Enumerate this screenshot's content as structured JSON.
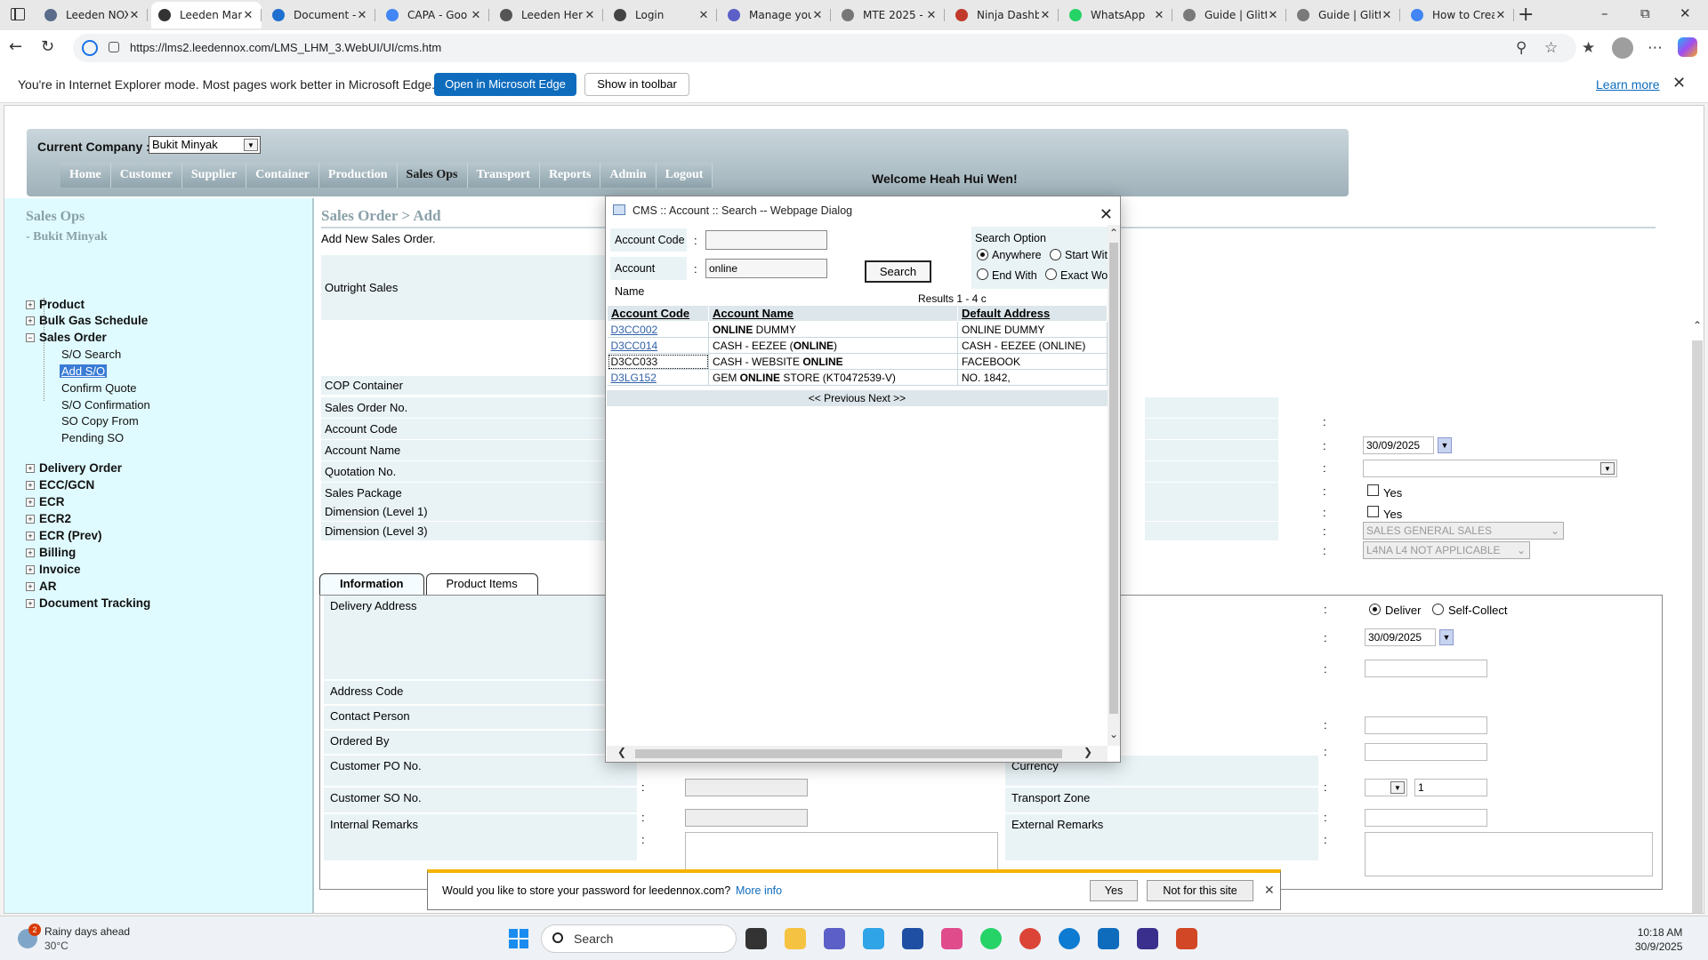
{
  "browser": {
    "tabs": [
      {
        "label": "Leeden NOX",
        "active": false,
        "icon": "globe-icon",
        "color": "#5a6b8c"
      },
      {
        "label": "Leeden Man",
        "active": true,
        "icon": "ie-icon",
        "color": "#333333"
      },
      {
        "label": "Document -",
        "active": false,
        "icon": "cloud-doc-icon",
        "color": "#1f6fd0"
      },
      {
        "label": "CAPA - Goo",
        "active": false,
        "icon": "google-icon",
        "color": "#4285f4"
      },
      {
        "label": "Leeden Her",
        "active": false,
        "icon": "map-pin-icon",
        "color": "#555555"
      },
      {
        "label": "Login",
        "active": false,
        "icon": "gmail-icon",
        "color": "#444444"
      },
      {
        "label": "Manage you",
        "active": false,
        "icon": "arrow-icon",
        "color": "#5b5fc7"
      },
      {
        "label": "MTE 2025 -",
        "active": false,
        "icon": "globe-icon",
        "color": "#777777"
      },
      {
        "label": "Ninja Dashb",
        "active": false,
        "icon": "ninja-icon",
        "color": "#c0392b"
      },
      {
        "label": "WhatsApp",
        "active": false,
        "icon": "whatsapp-icon",
        "color": "#25d366"
      },
      {
        "label": "Guide | Glitt",
        "active": false,
        "icon": "google-icon",
        "color": "#7a7a7a"
      },
      {
        "label": "Guide | Glitt",
        "active": false,
        "icon": "google-icon",
        "color": "#7a7a7a"
      },
      {
        "label": "How to Crea",
        "active": false,
        "icon": "google-icon",
        "color": "#4285f4"
      }
    ],
    "url": "https://lms2.leedennox.com/LMS_LHM_3.WebUI/UI/cms.htm"
  },
  "iebar": {
    "message": "You're in Internet Explorer mode. Most pages work better in Microsoft Edge.",
    "open_button": "Open in Microsoft Edge",
    "toolbar_button": "Show in toolbar",
    "learn_more": "Learn more"
  },
  "header": {
    "company_label": "Current Company :",
    "company_value": "Bukit Minyak",
    "menu": [
      "Home",
      "Customer",
      "Supplier",
      "Container",
      "Production",
      "Sales Ops",
      "Transport",
      "Reports",
      "Admin",
      "Logout"
    ],
    "active_menu": "Sales Ops",
    "welcome": "Welcome Heah Hui Wen!"
  },
  "sidebar": {
    "title": "Sales Ops",
    "subtitle": "- Bukit Minyak",
    "items": [
      {
        "label": "Product",
        "expanded": false
      },
      {
        "label": "Bulk Gas Schedule",
        "expanded": false
      },
      {
        "label": "Sales Order",
        "expanded": true
      },
      {
        "label": "Delivery Order",
        "expanded": false
      },
      {
        "label": "ECC/GCN",
        "expanded": false
      },
      {
        "label": "ECR",
        "expanded": false
      },
      {
        "label": "ECR2",
        "expanded": false
      },
      {
        "label": "ECR (Prev)",
        "expanded": false
      },
      {
        "label": "Billing",
        "expanded": false
      },
      {
        "label": "Invoice",
        "expanded": false
      },
      {
        "label": "AR",
        "expanded": false
      },
      {
        "label": "Document Tracking",
        "expanded": false
      }
    ],
    "sales_order_children": [
      "S/O Search",
      "Add S/O",
      "Confirm Quote",
      "S/O Confirmation",
      "SO Copy From",
      "Pending SO"
    ],
    "selected_child": "Add S/O"
  },
  "form": {
    "title": "Sales Order > Add",
    "description": "Add New Sales Order.",
    "rows": [
      "Outright Sales",
      "COP Container",
      "Sales Order No.",
      "Account Code",
      "Account Name",
      "Quotation No.",
      "Sales Package",
      "Dimension (Level 1)",
      "Dimension (Level 3)"
    ],
    "order_date": "30/09/2025",
    "yes_label": "Yes",
    "dimension1": "SALES GENERAL SALES",
    "dimension3": "L4NA L4 NOT APPLICABLE",
    "tabs": [
      "Information",
      "Product Items"
    ],
    "active_tab": "Information",
    "info_rows": [
      "Delivery Address",
      "Address Code",
      "Contact Person",
      "Ordered By",
      "Customer PO No.",
      "Customer SO No.",
      "Internal Remarks"
    ],
    "right_rows": [
      "Currency",
      "Transport Zone",
      "External Remarks"
    ],
    "deliver_label": "Deliver",
    "selfcollect_label": "Self-Collect",
    "delivery_date": "30/09/2025",
    "currency_rate": "1"
  },
  "dialog": {
    "title": "CMS :: Account :: Search -- Webpage Dialog",
    "account_code_label": "Account Code",
    "account_name_label": "Account Name",
    "account_code_value": "",
    "account_name_value": "online",
    "search_button": "Search",
    "search_option_label": "Search Option",
    "options": [
      "Anywhere",
      "Start Wit",
      "End With",
      "Exact Wo"
    ],
    "selected_option": "Anywhere",
    "results_text": "Results 1 - 4 c",
    "columns": [
      "Account Code",
      "Account Name",
      "Default Address"
    ],
    "rows": [
      {
        "code": "D3CC002",
        "name_pre": "",
        "name_bold": "ONLINE",
        "name_post": " DUMMY",
        "address": "ONLINE DUMMY"
      },
      {
        "code": "D3CC014",
        "name_pre": "CASH - EEZEE (",
        "name_bold": "ONLINE",
        "name_post": ")",
        "address": "CASH - EEZEE (ONLINE)"
      },
      {
        "code": "D3CC033",
        "name_pre": "CASH - WEBSITE ",
        "name_bold": "ONLINE",
        "name_post": "",
        "address": "FACEBOOK"
      },
      {
        "code": "D3LG152",
        "name_pre": "GEM ",
        "name_bold": "ONLINE",
        "name_post": " STORE (KT0472539-V)",
        "address": "NO. 1842,"
      }
    ],
    "pager": "<< Previous Next >>"
  },
  "password_bar": {
    "message": "Would you like to store your password for leedennox.com?",
    "more_info": "More info",
    "yes": "Yes",
    "no": "Not for this site"
  },
  "taskbar": {
    "weather_badge": "2",
    "weather_line1": "Rainy days ahead",
    "weather_line2": "30°C",
    "search_placeholder": "Search",
    "time": "10:18 AM",
    "date": "30/9/2025",
    "apps": [
      {
        "icon": "task-view-icon",
        "color": "#333333"
      },
      {
        "icon": "file-explorer-icon",
        "color": "#f5c242"
      },
      {
        "icon": "teams-icon",
        "color": "#5b5fc7"
      },
      {
        "icon": "copilot-icon",
        "color": "#2fa4e7"
      },
      {
        "icon": "outlook-calendar-icon",
        "color": "#1e4fa3"
      },
      {
        "icon": "snipping-tool-icon",
        "color": "#e04b8c"
      },
      {
        "icon": "whatsapp-icon",
        "color": "#25d366"
      },
      {
        "icon": "chrome-icon",
        "color": "#db4437"
      },
      {
        "icon": "edge-icon",
        "color": "#0c7bd1"
      },
      {
        "icon": "outlook-icon",
        "color": "#0f6cbd"
      },
      {
        "icon": "quick-assist-icon",
        "color": "#3a2f8c"
      },
      {
        "icon": "powerpoint-icon",
        "color": "#d24726"
      }
    ]
  }
}
